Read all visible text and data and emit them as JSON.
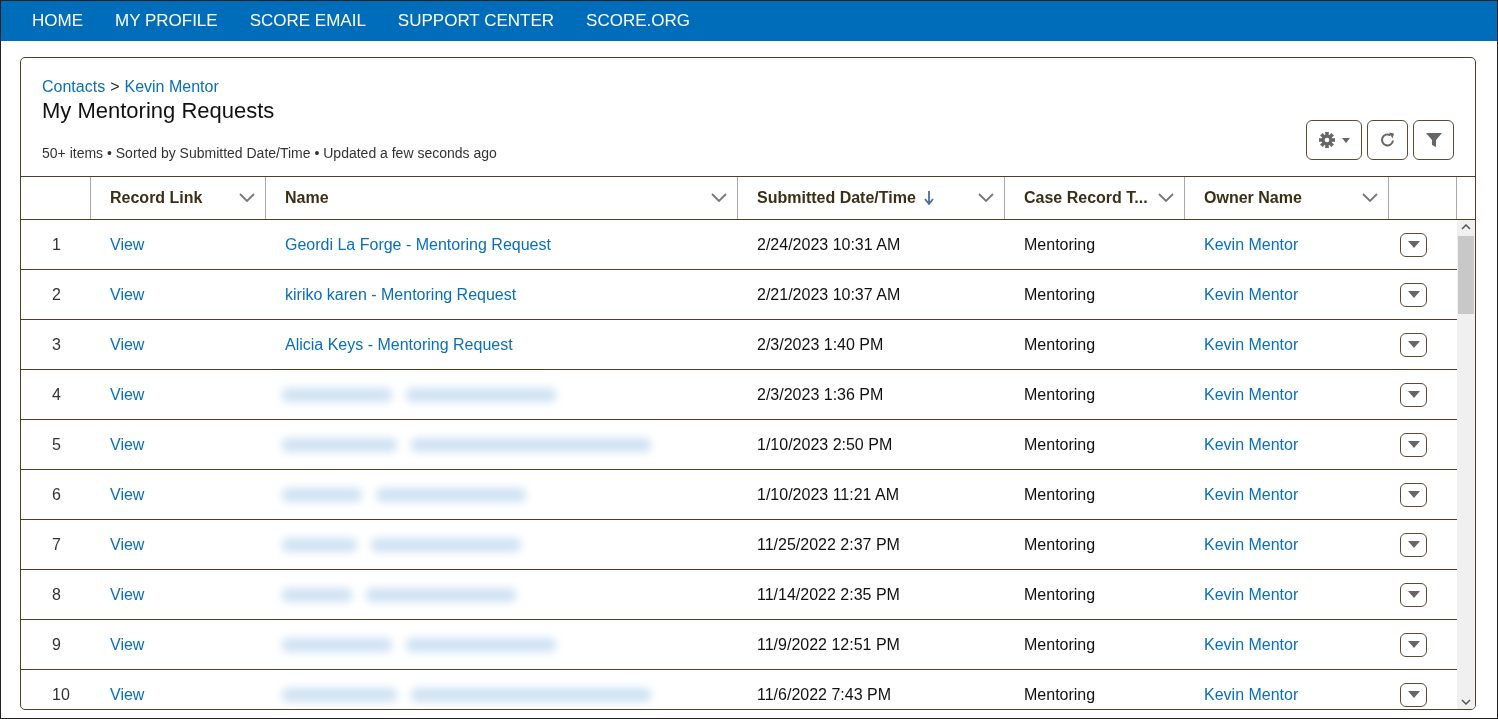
{
  "nav": [
    "HOME",
    "MY PROFILE",
    "SCORE EMAIL",
    "SUPPORT CENTER",
    "SCORE.ORG"
  ],
  "breadcrumbs": [
    "Contacts",
    "Kevin Mentor"
  ],
  "breadcrumb_separator": ">",
  "title": "My Mentoring Requests",
  "meta": "50+ items • Sorted by Submitted Date/Time • Updated a few seconds ago",
  "columns": [
    {
      "label": "Record Link",
      "sorted": false
    },
    {
      "label": "Name",
      "sorted": false
    },
    {
      "label": "Submitted Date/Time",
      "sorted": true
    },
    {
      "label": "Case Record T...",
      "sorted": false
    },
    {
      "label": "Owner Name",
      "sorted": false
    }
  ],
  "rows": [
    {
      "number": "1",
      "record_link": "View",
      "name": {
        "kind": "link",
        "text": "Geordi La Forge - Mentoring Request"
      },
      "submitted": "2/24/2023 10:31 AM",
      "case_record_type": "Mentoring",
      "owner": "Kevin Mentor"
    },
    {
      "number": "2",
      "record_link": "View",
      "name": {
        "kind": "link",
        "text": "kiriko karen - Mentoring Request"
      },
      "submitted": "2/21/2023 10:37 AM",
      "case_record_type": "Mentoring",
      "owner": "Kevin Mentor"
    },
    {
      "number": "3",
      "record_link": "View",
      "name": {
        "kind": "link",
        "text": "Alicia Keys - Mentoring Request"
      },
      "submitted": "2/3/2023 1:40 PM",
      "case_record_type": "Mentoring",
      "owner": "Kevin Mentor"
    },
    {
      "number": "4",
      "record_link": "View",
      "name": {
        "kind": "blurred"
      },
      "submitted": "2/3/2023 1:36 PM",
      "case_record_type": "Mentoring",
      "owner": "Kevin Mentor"
    },
    {
      "number": "5",
      "record_link": "View",
      "name": {
        "kind": "blurred"
      },
      "submitted": "1/10/2023 2:50 PM",
      "case_record_type": "Mentoring",
      "owner": "Kevin Mentor"
    },
    {
      "number": "6",
      "record_link": "View",
      "name": {
        "kind": "blurred"
      },
      "submitted": "1/10/2023 11:21 AM",
      "case_record_type": "Mentoring",
      "owner": "Kevin Mentor"
    },
    {
      "number": "7",
      "record_link": "View",
      "name": {
        "kind": "blurred"
      },
      "submitted": "11/25/2022 2:37 PM",
      "case_record_type": "Mentoring",
      "owner": "Kevin Mentor"
    },
    {
      "number": "8",
      "record_link": "View",
      "name": {
        "kind": "blurred"
      },
      "submitted": "11/14/2022 2:35 PM",
      "case_record_type": "Mentoring",
      "owner": "Kevin Mentor"
    },
    {
      "number": "9",
      "record_link": "View",
      "name": {
        "kind": "blurred"
      },
      "submitted": "11/9/2022 12:51 PM",
      "case_record_type": "Mentoring",
      "owner": "Kevin Mentor"
    },
    {
      "number": "10",
      "record_link": "View",
      "name": {
        "kind": "blurred"
      },
      "submitted": "11/6/2022 7:43 PM",
      "case_record_type": "Mentoring",
      "owner": "Kevin Mentor"
    }
  ]
}
